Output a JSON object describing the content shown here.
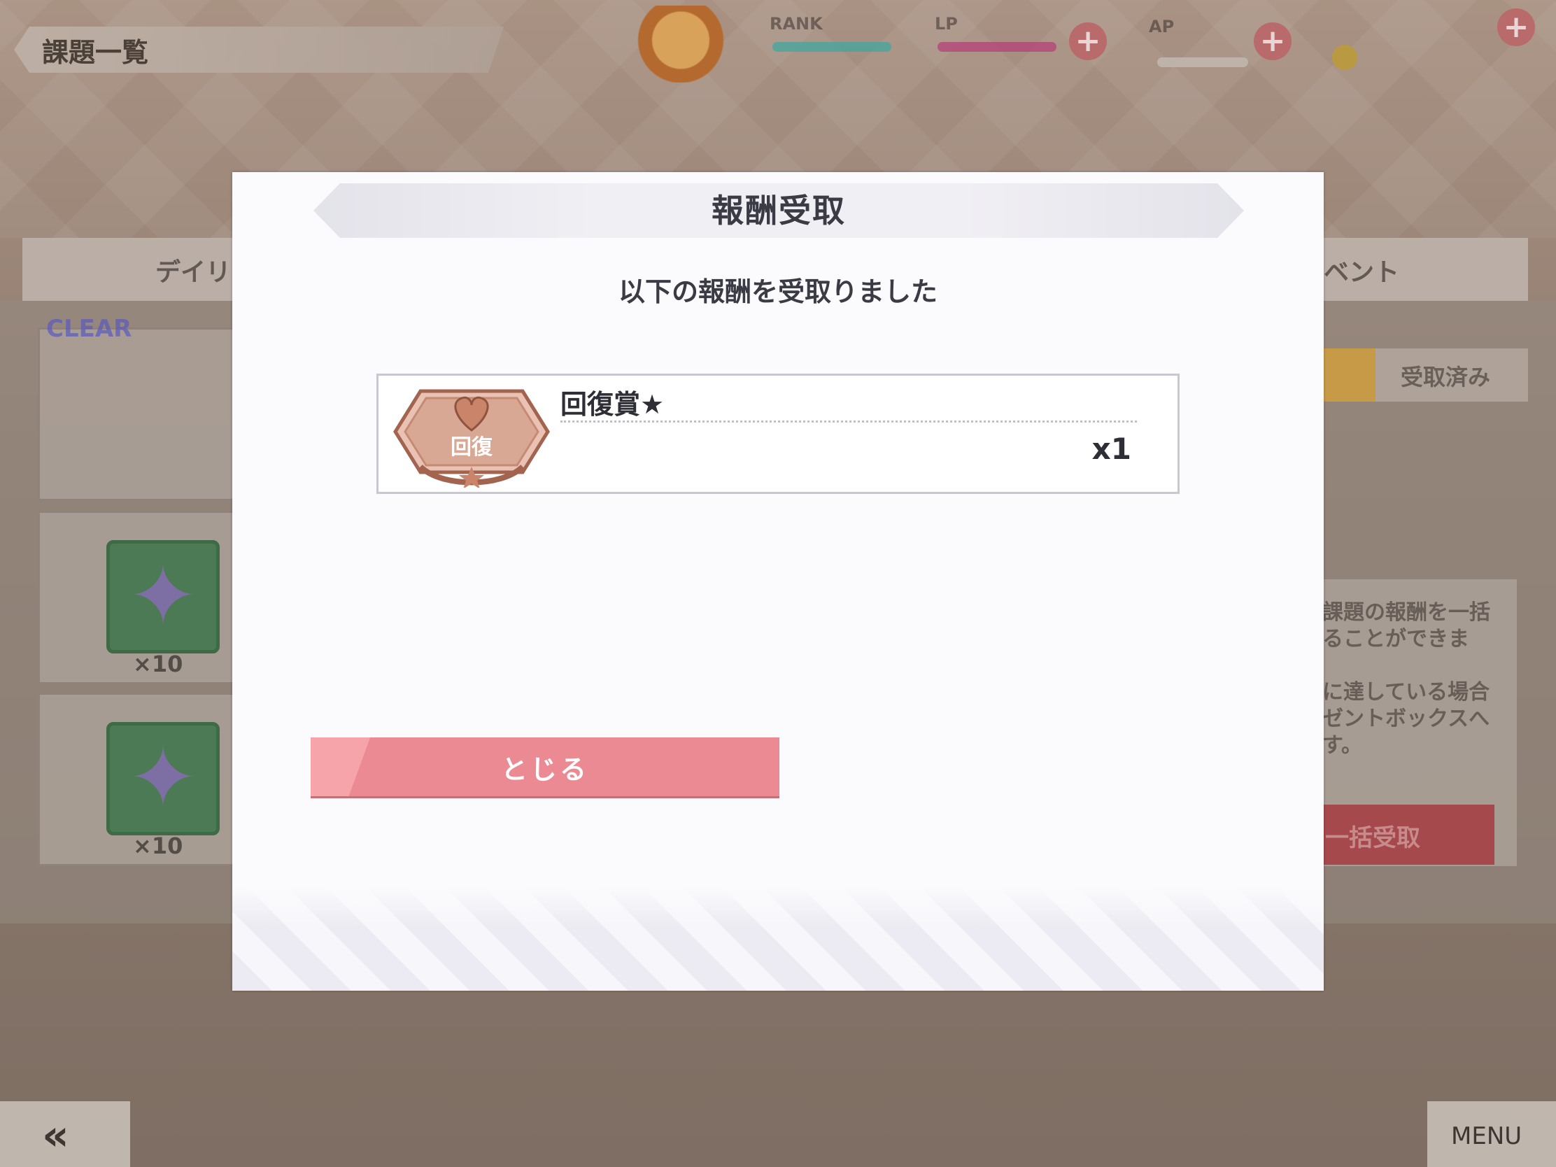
{
  "background": {
    "screen_title": "課題一覧",
    "tabs": {
      "left": "デイリ",
      "right": "ベント"
    },
    "stats": {
      "rank_label": "RANK",
      "lp_label": "LP",
      "ap_label": "AP"
    },
    "clear_tag": "CLEAR",
    "card_counts": [
      "×10",
      "×10"
    ],
    "received_tab": "受取済み",
    "info_lines": [
      "課題の報酬を一括",
      "ることができま",
      "に達している場合",
      "ゼントボックスへ",
      "す。"
    ],
    "claim_all_label": "一括受取",
    "back_label": "«",
    "menu_label": "MENU"
  },
  "modal": {
    "title": "報酬受取",
    "message": "以下の報酬を受取りました",
    "rewards": [
      {
        "name": "回復賞★",
        "icon_label": "回復",
        "quantity": "x1",
        "icon": "heart-medal-icon"
      }
    ],
    "close_label": "とじる"
  },
  "colors": {
    "close_button": "#ec8a93",
    "modal_bg": "#fbfbfd",
    "medal_bronze": "#c9907a"
  }
}
